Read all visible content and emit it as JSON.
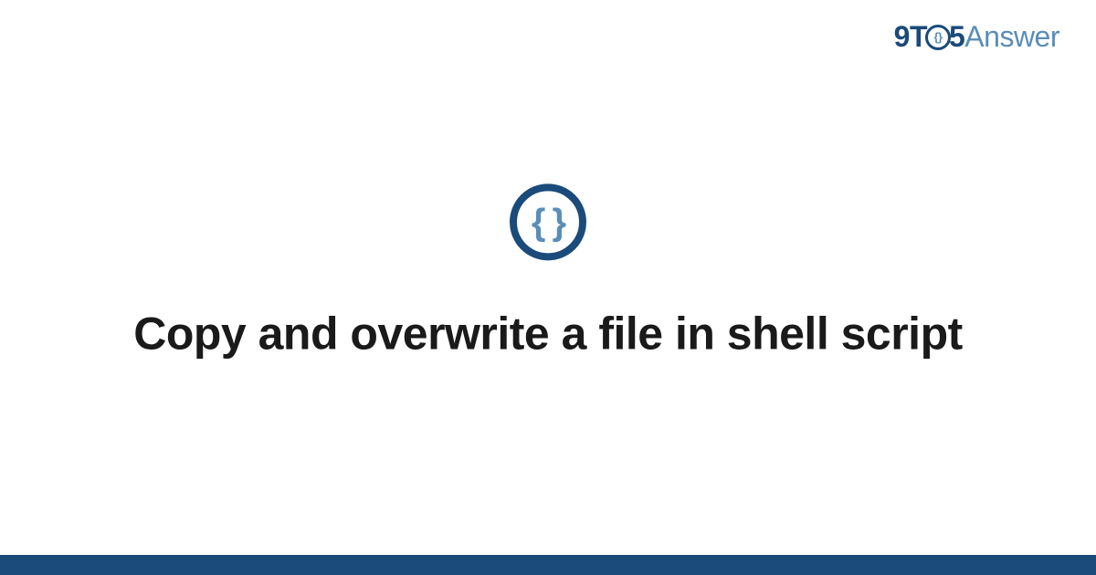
{
  "logo": {
    "part1": "9T",
    "circle_inner": "{}",
    "part2": "5",
    "part3": "Answer"
  },
  "icon": {
    "braces": "{ }"
  },
  "title": "Copy and overwrite a file in shell script",
  "colors": {
    "brand_dark": "#1a4b7a",
    "brand_light": "#5a8db8"
  }
}
